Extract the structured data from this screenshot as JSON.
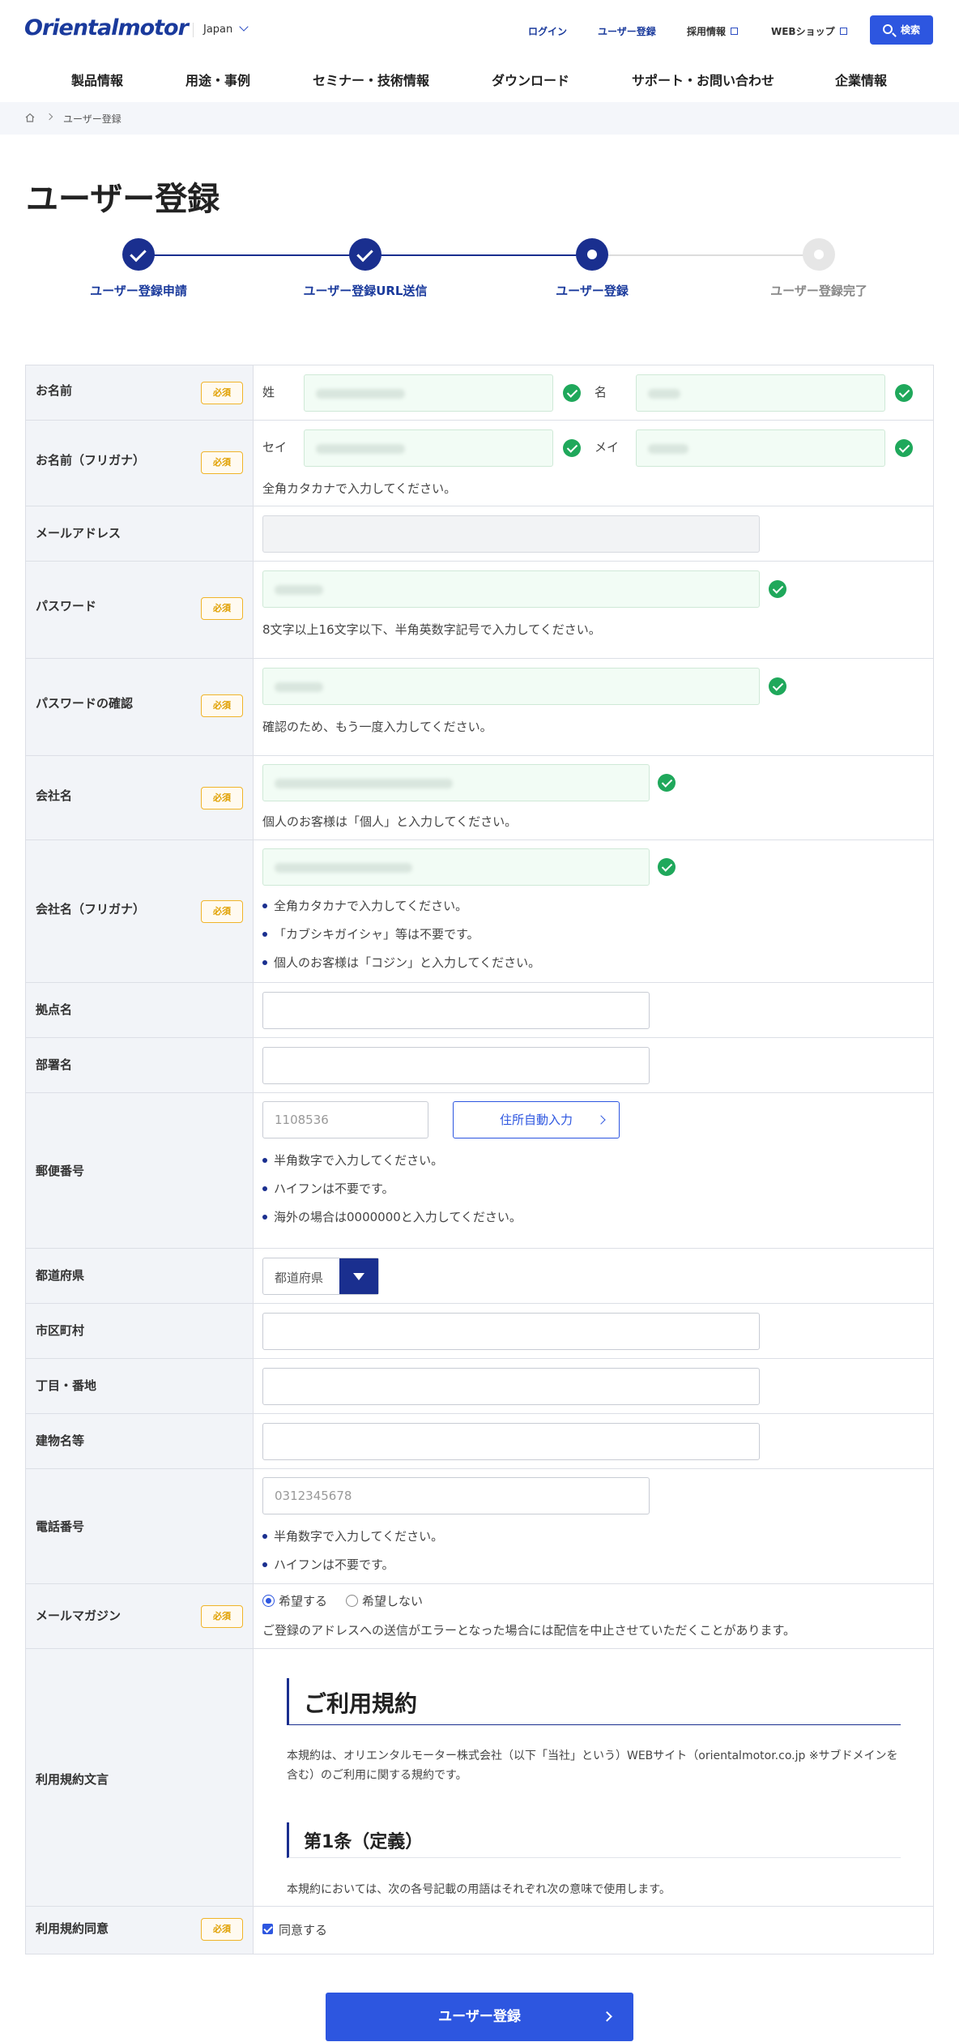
{
  "header": {
    "logo": "Orientalmotor",
    "region": "Japan",
    "links": {
      "login": "ログイン",
      "register": "ユーザー登録",
      "careers": "採用情報",
      "webshop": "WEBショップ"
    },
    "search_label": "検索"
  },
  "nav": [
    "製品情報",
    "用途・事例",
    "セミナー・技術情報",
    "ダウンロード",
    "サポート・お問い合わせ",
    "企業情報"
  ],
  "breadcrumb": {
    "current": "ユーザー登録"
  },
  "page_title": "ユーザー登録",
  "steps": [
    {
      "label": "ユーザー登録申請",
      "state": "done"
    },
    {
      "label": "ユーザー登録URL送信",
      "state": "done"
    },
    {
      "label": "ユーザー登録",
      "state": "current"
    },
    {
      "label": "ユーザー登録完了",
      "state": "todo"
    }
  ],
  "required_badge": "必須",
  "colors": {
    "primary": "#2d56e0",
    "navy": "#1a2f8f",
    "success": "#1fa85b",
    "required": "#e0a000"
  },
  "form": {
    "name": {
      "label": "お名前",
      "sei": "姓",
      "mei": "名"
    },
    "kana": {
      "label": "お名前（フリガナ）",
      "sei": "セイ",
      "mei": "メイ",
      "note": "全角カタカナで入力してください。"
    },
    "email": {
      "label": "メールアドレス"
    },
    "password": {
      "label": "パスワード",
      "note": "8文字以上16文字以下、半角英数字記号で入力してください。"
    },
    "password_confirm": {
      "label": "パスワードの確認",
      "note": "確認のため、もう一度入力してください。"
    },
    "company": {
      "label": "会社名",
      "note": "個人のお客様は「個人」と入力してください。"
    },
    "company_kana": {
      "label": "会社名（フリガナ）",
      "notes": [
        "全角カタカナで入力してください。",
        "「カブシキガイシャ」等は不要です。",
        "個人のお客様は「コジン」と入力してください。"
      ]
    },
    "branch": {
      "label": "拠点名"
    },
    "department": {
      "label": "部署名"
    },
    "postal": {
      "label": "郵便番号",
      "placeholder": "1108536",
      "button": "住所自動入力",
      "notes": [
        "半角数字で入力してください。",
        "ハイフンは不要です。",
        "海外の場合は0000000と入力してください。"
      ]
    },
    "prefecture": {
      "label": "都道府県",
      "selected": "都道府県"
    },
    "city": {
      "label": "市区町村"
    },
    "street": {
      "label": "丁目・番地"
    },
    "building": {
      "label": "建物名等"
    },
    "phone": {
      "label": "電話番号",
      "placeholder": "0312345678",
      "notes": [
        "半角数字で入力してください。",
        "ハイフンは不要です。"
      ]
    },
    "magazine": {
      "label": "メールマガジン",
      "opt_yes": "希望する",
      "opt_no": "希望しない",
      "selected": "希望する",
      "note": "ご登録のアドレスへの送信がエラーとなった場合には配信を中止させていただくことがあります。"
    },
    "terms": {
      "label": "利用規約文言",
      "heading": "ご利用規約",
      "intro": "本規約は、オリエンタルモーター株式会社（以下「当社」という）WEBサイト（orientalmotor.co.jp ※サブドメインを含む）のご利用に関する規約です。",
      "article1": "第1条（定義）",
      "article1_text": "本規約においては、次の各号記載の用語はそれぞれ次の意味で使用します。"
    },
    "agree": {
      "label": "利用規約同意",
      "checkbox": "同意する",
      "checked": true
    }
  },
  "submit_label": "ユーザー登録"
}
